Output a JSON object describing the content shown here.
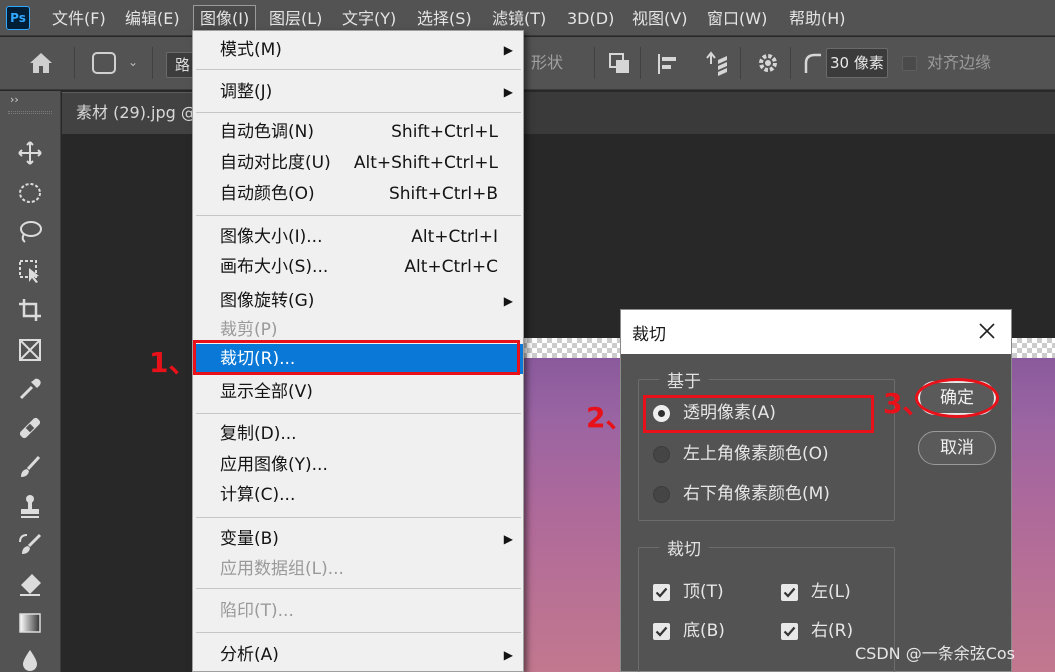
{
  "menubar": {
    "logo": "Ps",
    "items": [
      "文件(F)",
      "编辑(E)",
      "图像(I)",
      "图层(L)",
      "文字(Y)",
      "选择(S)",
      "滤镜(T)",
      "3D(D)",
      "视图(V)",
      "窗口(W)",
      "帮助(H)"
    ]
  },
  "options_bar": {
    "path_select": "路",
    "shape_label": "形状",
    "radius_value": "30 像素",
    "align_edges": "对齐边缘"
  },
  "toolbar": {
    "collapse": "››"
  },
  "document": {
    "tab": "素材 (29).jpg @"
  },
  "image_menu": {
    "items": [
      {
        "label": "模式(M)",
        "shortcut": "",
        "submenu": true
      },
      {
        "label": "调整(J)",
        "shortcut": "",
        "submenu": true
      },
      {
        "label": "自动色调(N)",
        "shortcut": "Shift+Ctrl+L"
      },
      {
        "label": "自动对比度(U)",
        "shortcut": "Alt+Shift+Ctrl+L"
      },
      {
        "label": "自动颜色(O)",
        "shortcut": "Shift+Ctrl+B"
      },
      {
        "label": "图像大小(I)...",
        "shortcut": "Alt+Ctrl+I"
      },
      {
        "label": "画布大小(S)...",
        "shortcut": "Alt+Ctrl+C"
      },
      {
        "label": "图像旋转(G)",
        "shortcut": "",
        "submenu": true
      },
      {
        "label": "裁剪(P)",
        "shortcut": "",
        "disabled": true
      },
      {
        "label": "裁切(R)...",
        "shortcut": "",
        "highlighted": true
      },
      {
        "label": "显示全部(V)",
        "shortcut": ""
      },
      {
        "label": "复制(D)...",
        "shortcut": ""
      },
      {
        "label": "应用图像(Y)...",
        "shortcut": ""
      },
      {
        "label": "计算(C)...",
        "shortcut": ""
      },
      {
        "label": "变量(B)",
        "shortcut": "",
        "submenu": true
      },
      {
        "label": "应用数据组(L)...",
        "shortcut": "",
        "disabled": true
      },
      {
        "label": "陷印(T)...",
        "shortcut": "",
        "disabled": true
      },
      {
        "label": "分析(A)",
        "shortcut": "",
        "submenu": true
      }
    ]
  },
  "trim_dialog": {
    "title": "裁切",
    "based_on": {
      "title": "基于",
      "options": [
        "透明像素(A)",
        "左上角像素颜色(O)",
        "右下角像素颜色(M)"
      ],
      "selected": 0
    },
    "trim_away": {
      "title": "裁切",
      "checks": [
        {
          "label": "顶(T)",
          "checked": true
        },
        {
          "label": "左(L)",
          "checked": true
        },
        {
          "label": "底(B)",
          "checked": true
        },
        {
          "label": "右(R)",
          "checked": true
        }
      ]
    },
    "ok_label": "确定",
    "cancel_label": "取消"
  },
  "annotations": {
    "step1": "1、",
    "step2": "2、",
    "step3": "3、"
  },
  "watermark": "CSDN @一条余弦Cos",
  "colors": {
    "highlight": "#0a78d7",
    "annotation": "#e8111a",
    "panel": "#535353"
  }
}
